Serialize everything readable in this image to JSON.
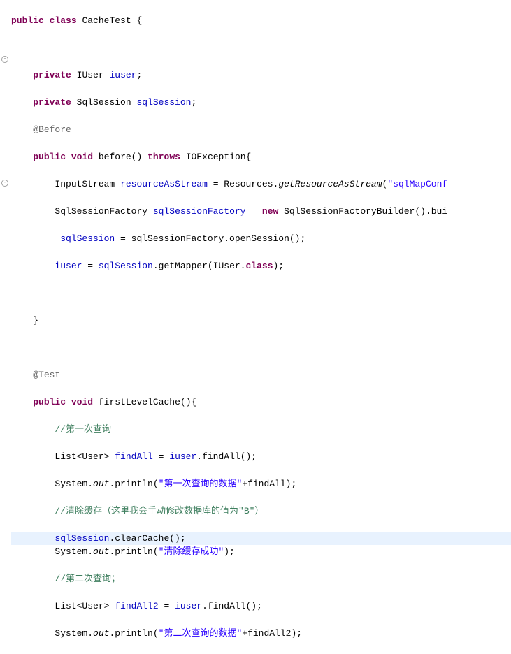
{
  "code": {
    "l1_kw1": "public",
    "l1_kw2": "class",
    "l1_class": "CacheTest {",
    "l3_kw": "private",
    "l3_type": "IUser",
    "l3_field": "iuser",
    "l4_kw": "private",
    "l4_type": "SqlSession",
    "l4_field": "sqlSession",
    "l5_ann": "@Before",
    "l6_kw1": "public",
    "l6_kw2": "void",
    "l6_method": "before()",
    "l6_kw3": "throws",
    "l6_exc": "IOException{",
    "l7_type": "InputStream",
    "l7_var": "resourceAsStream",
    "l7_eq": " = Resources.",
    "l7_static": "getResourceAsStream",
    "l7_str": "\"sqlMapConf",
    "l8_type": "SqlSessionFactory",
    "l8_var": "sqlSessionFactory",
    "l8_eq": " = ",
    "l8_kw": "new",
    "l8_call": " SqlSessionFactoryBuilder().bui",
    "l9_field": "sqlSession",
    "l9_rest": " = sqlSessionFactory.openSession();",
    "l10_field": "iuser",
    "l10_eq": " = ",
    "l10_field2": "sqlSession",
    "l10_rest": ".getMapper(IUser.",
    "l10_kw": "class",
    "l10_end": ");",
    "l12_brace": "}",
    "l14_ann": "@Test",
    "l15_kw1": "public",
    "l15_kw2": "void",
    "l15_method": "firstLevelCache(){",
    "l16_comment": "//第一次查询",
    "l17_type": "List<User>",
    "l17_var": "findAll",
    "l17_eq": " = ",
    "l17_field": "iuser",
    "l17_rest": ".findAll();",
    "l18_sys": "System.",
    "l18_out": "out",
    "l18_method": ".println(",
    "l18_str": "\"第一次查询的数据\"",
    "l18_rest": "+findAll);",
    "l19_comment": "//清除缓存（这里我会手动修改数据库的值为\"B\"）",
    "l20_field": "sqlSession",
    "l20_rest": ".clearCache();",
    "l21_sys": "System.",
    "l21_out": "out",
    "l21_method": ".println(",
    "l21_str": "\"清除缓存成功\"",
    "l21_rest": ");",
    "l22_comment": "//第二次查询；",
    "l23_type": "List<User>",
    "l23_var": "findAll2",
    "l23_eq": " = ",
    "l23_field": "iuser",
    "l23_rest": ".findAll();",
    "l24_sys": "System.",
    "l24_out": "out",
    "l24_method": ".println(",
    "l24_str": "\"第二次查询的数据\"",
    "l24_rest": "+findAll2);"
  }
}
